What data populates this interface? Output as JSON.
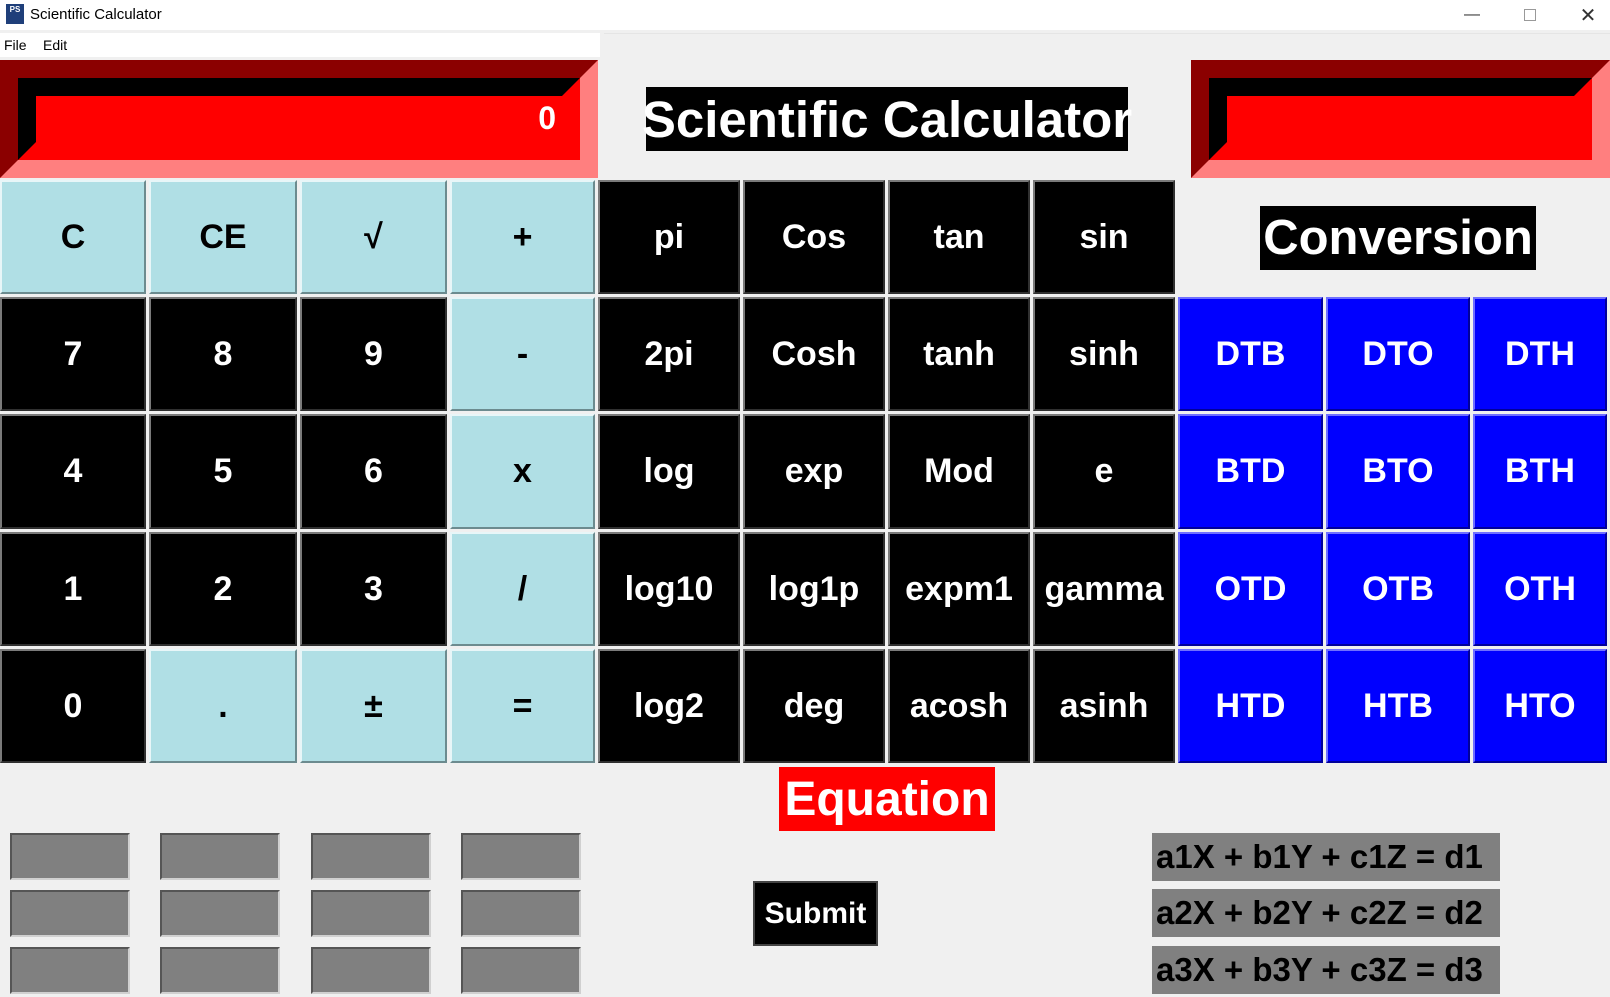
{
  "window": {
    "title": "Scientific Calculator",
    "icon_text": "PS",
    "controls": [
      "minimize",
      "maximize",
      "close"
    ]
  },
  "menu": [
    "File",
    "Edit"
  ],
  "display": {
    "value": "0",
    "secondary_value": ""
  },
  "title": "Scientific Calculator",
  "conversion_label": "Conversion",
  "equation_label": "Equation",
  "submit_label": "Submit",
  "colors": {
    "display_red": "#ff0000",
    "light_blue": "#b0dfe5",
    "conversion_blue": "#0000ff",
    "equation_red": "#ff0000",
    "input_gray": "#808080"
  },
  "buttons": [
    [
      "C",
      "CE",
      "√",
      "+",
      "pi",
      "Cos",
      "tan",
      "sin"
    ],
    [
      "7",
      "8",
      "9",
      "-",
      "2pi",
      "Cosh",
      "tanh",
      "sinh"
    ],
    [
      "4",
      "5",
      "6",
      "x",
      "log",
      "exp",
      "Mod",
      "e"
    ],
    [
      "1",
      "2",
      "3",
      "/",
      "log10",
      "log1p",
      "expm1",
      "gamma"
    ],
    [
      "0",
      ".",
      "±",
      "=",
      "log2",
      "deg",
      "acosh",
      "asinh"
    ]
  ],
  "conversion_buttons": [
    [
      "DTB",
      "DTO",
      "DTH"
    ],
    [
      "BTD",
      "BTO",
      "BTH"
    ],
    [
      "OTD",
      "OTB",
      "OTH"
    ],
    [
      "HTD",
      "HTB",
      "HTO"
    ]
  ],
  "equations": [
    "a1X + b1Y + c1Z = d1",
    "a2X + b2Y + c2Z = d2",
    "a3X + b3Y + c3Z = d3"
  ],
  "equation_inputs": [
    [
      "",
      "",
      "",
      ""
    ],
    [
      "",
      "",
      "",
      ""
    ],
    [
      "",
      "",
      "",
      ""
    ]
  ]
}
